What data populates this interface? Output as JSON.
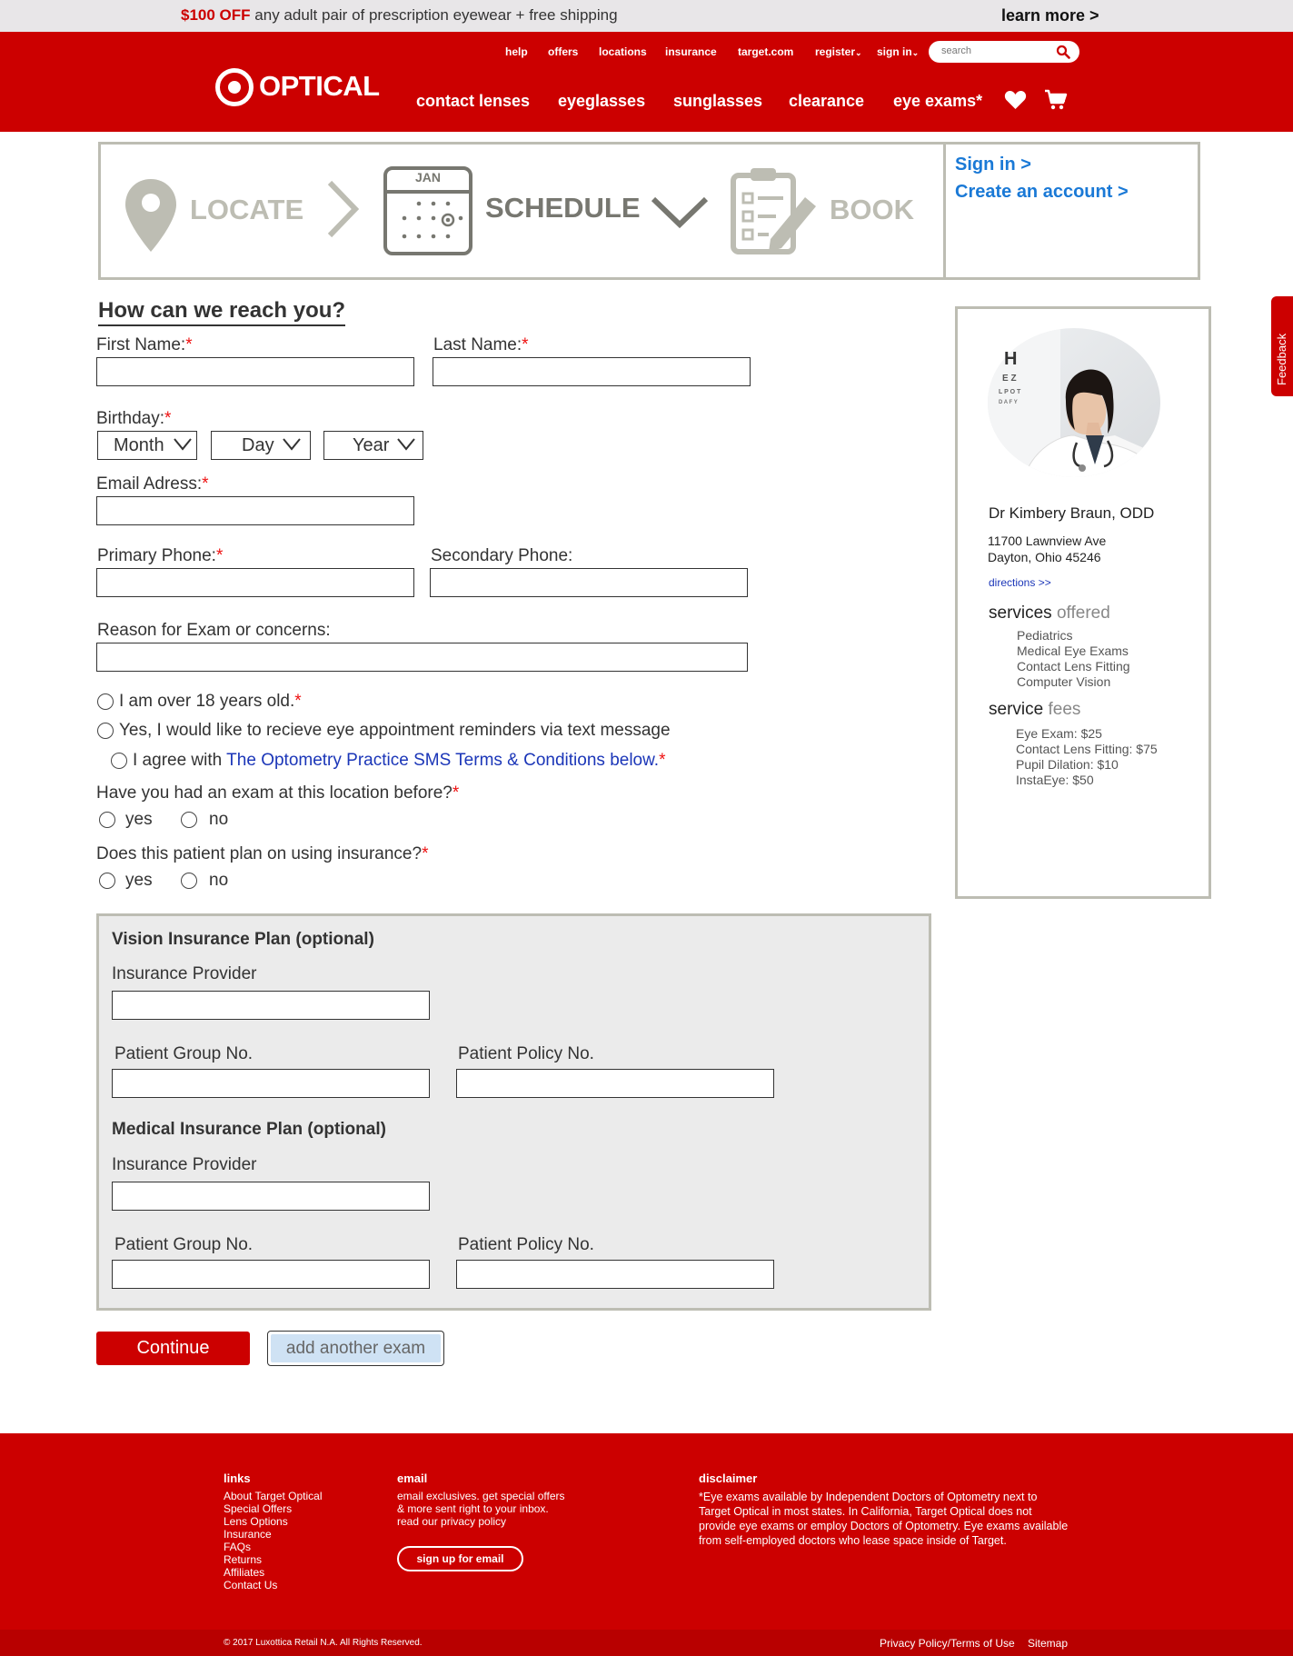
{
  "promo": {
    "deal_amount": "$100 OFF",
    "deal_text": "any adult pair of prescription eyewear + free shipping",
    "learn_more": "learn more >"
  },
  "header": {
    "util_links": [
      "help",
      "offers",
      "locations",
      "insurance",
      "target.com",
      "register",
      "sign in"
    ],
    "search_placeholder": "search",
    "logo_text": "OPTICAL",
    "nav": [
      "contact lenses",
      "eyeglasses",
      "sunglasses",
      "clearance",
      "eye exams*"
    ]
  },
  "steps": {
    "locate": "LOCATE",
    "calendar_month": "JAN",
    "schedule": "SCHEDULE",
    "book": "BOOK",
    "sign_in": "Sign in >",
    "create_account": "Create an account >"
  },
  "form": {
    "heading": "How can we reach you?",
    "first_name": "First Name:",
    "last_name": "Last Name:",
    "birthday": "Birthday:",
    "month": "Month",
    "day": "Day",
    "year": "Year",
    "email": "Email Adress:",
    "primary_phone": "Primary Phone:",
    "secondary_phone": "Secondary Phone:",
    "reason": "Reason for Exam or concerns:",
    "over18": "I am over 18 years old.",
    "sms_reminders": "Yes, I would like to recieve eye appointment reminders via text message",
    "agree_prefix": "I agree with",
    "agree_link": "The Optometry Practice SMS Terms & Conditions below.",
    "exam_before": "Have you had an exam at this location before?",
    "insurance_q": "Does this patient plan on using insurance?",
    "yes": "yes",
    "no": "no",
    "required_mark": "*"
  },
  "insurance": {
    "vision_title": "Vision Insurance Plan (optional)",
    "medical_title": "Medical Insurance Plan (optional)",
    "provider": "Insurance Provider",
    "group_no": "Patient Group No.",
    "policy_no": "Patient Policy No."
  },
  "buttons": {
    "continue": "Continue",
    "add_exam": "add another exam"
  },
  "doctor": {
    "name": "Dr Kimbery Braun, ODD",
    "address1": "11700 Lawnview Ave",
    "address2": "Dayton, Ohio 45246",
    "directions": "directions >>",
    "services_title_a": "services",
    "services_title_b": "offered",
    "services": [
      "Pediatrics",
      "Medical Eye Exams",
      "Contact Lens Fitting",
      "Computer Vision"
    ],
    "fees_title_a": "service",
    "fees_title_b": "fees",
    "fees": [
      "Eye Exam: $25",
      "Contact Lens Fitting: $75",
      "Pupil Dilation: $10",
      "InstaEye: $50"
    ],
    "chart_letters": [
      "H",
      "E Z",
      "L P O T",
      "D A F Y"
    ]
  },
  "feedback": "Feedback",
  "footer": {
    "links_title": "links",
    "links": [
      "About Target Optical",
      "Special Offers",
      "Lens Options",
      "Insurance",
      "FAQs",
      "Returns",
      "Affiliates",
      "Contact Us"
    ],
    "email_title": "email",
    "email_lines": [
      "email exclusives. get special offers",
      "& more sent right to your inbox.",
      "read our privacy policy"
    ],
    "email_button": "sign up for email",
    "disclaimer_title": "disclaimer",
    "disclaimer": "*Eye exams available by Independent Doctors of Optometry next to Target Optical in most states. In California, Target Optical does not provide eye exams or employ Doctors of Optometry. Eye exams available from self-employed doctors who lease space inside of Target.",
    "copyright": "© 2017 Luxottica Retail N.A. All Rights Reserved.",
    "privacy": "Privacy Policy/Terms of Use",
    "sitemap": "Sitemap"
  },
  "colors": {
    "brand_red": "#cc0000",
    "link_blue": "#1a79d6",
    "step_gray": "#bdbdb3"
  }
}
